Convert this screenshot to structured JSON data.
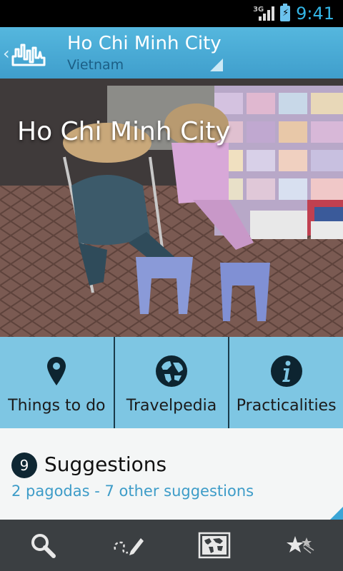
{
  "status_bar": {
    "network_type": "3G",
    "signal_icon": "signal-bars-icon",
    "battery_icon": "battery-charging-icon",
    "time": "9:41"
  },
  "action_bar": {
    "up_icon": "chevron-left-icon",
    "logo_icon": "city-skyline-logo-icon",
    "title": "Ho Chi Minh City",
    "subtitle": "Vietnam"
  },
  "hero": {
    "title": "Ho Chi Minh City"
  },
  "tiles": [
    {
      "label": "Things to do",
      "icon": "map-pin-icon"
    },
    {
      "label": "Travelpedia",
      "icon": "globe-icon"
    },
    {
      "label": "Practicalities",
      "icon": "info-icon"
    }
  ],
  "suggestions": {
    "count": "9",
    "title": "Suggestions",
    "link_text": "2 pagodas - 7 other suggestions"
  },
  "bottom_nav": [
    {
      "icon": "search-icon"
    },
    {
      "icon": "draw-route-icon"
    },
    {
      "icon": "world-map-icon"
    },
    {
      "icon": "favorites-stars-icon"
    }
  ],
  "colors": {
    "action_bar": "#4aaed6",
    "tile_bg": "#7ec6e3",
    "link": "#3d9cc8",
    "status_time": "#33b5e5"
  }
}
